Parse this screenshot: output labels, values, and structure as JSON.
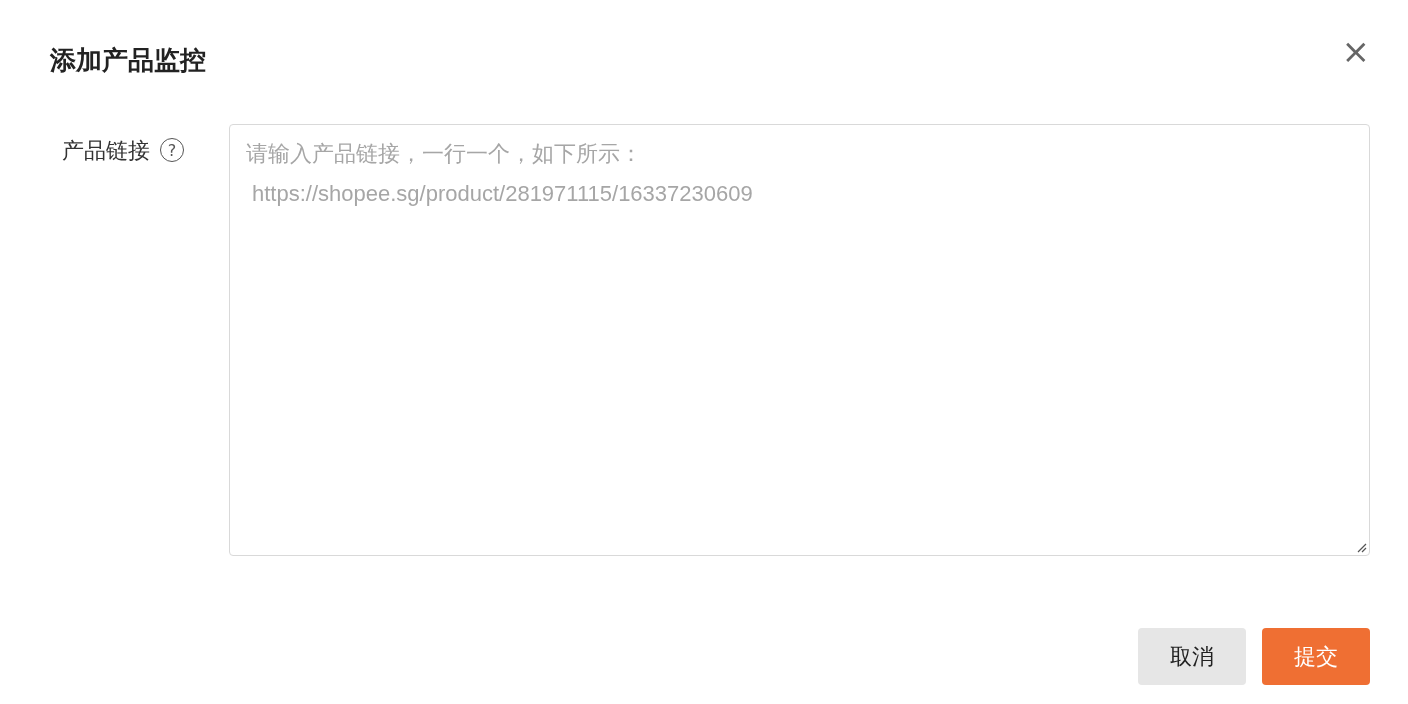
{
  "dialog": {
    "title": "添加产品监控",
    "close": "×"
  },
  "field": {
    "label": "产品链接",
    "help": "?",
    "placeholder": "请输入产品链接，一行一个，如下所示：\n https://shopee.sg/product/281971115/16337230609"
  },
  "buttons": [
    {
      "label": "取消",
      "kind": "secondary"
    },
    {
      "label": "提交",
      "kind": "primary"
    }
  ]
}
